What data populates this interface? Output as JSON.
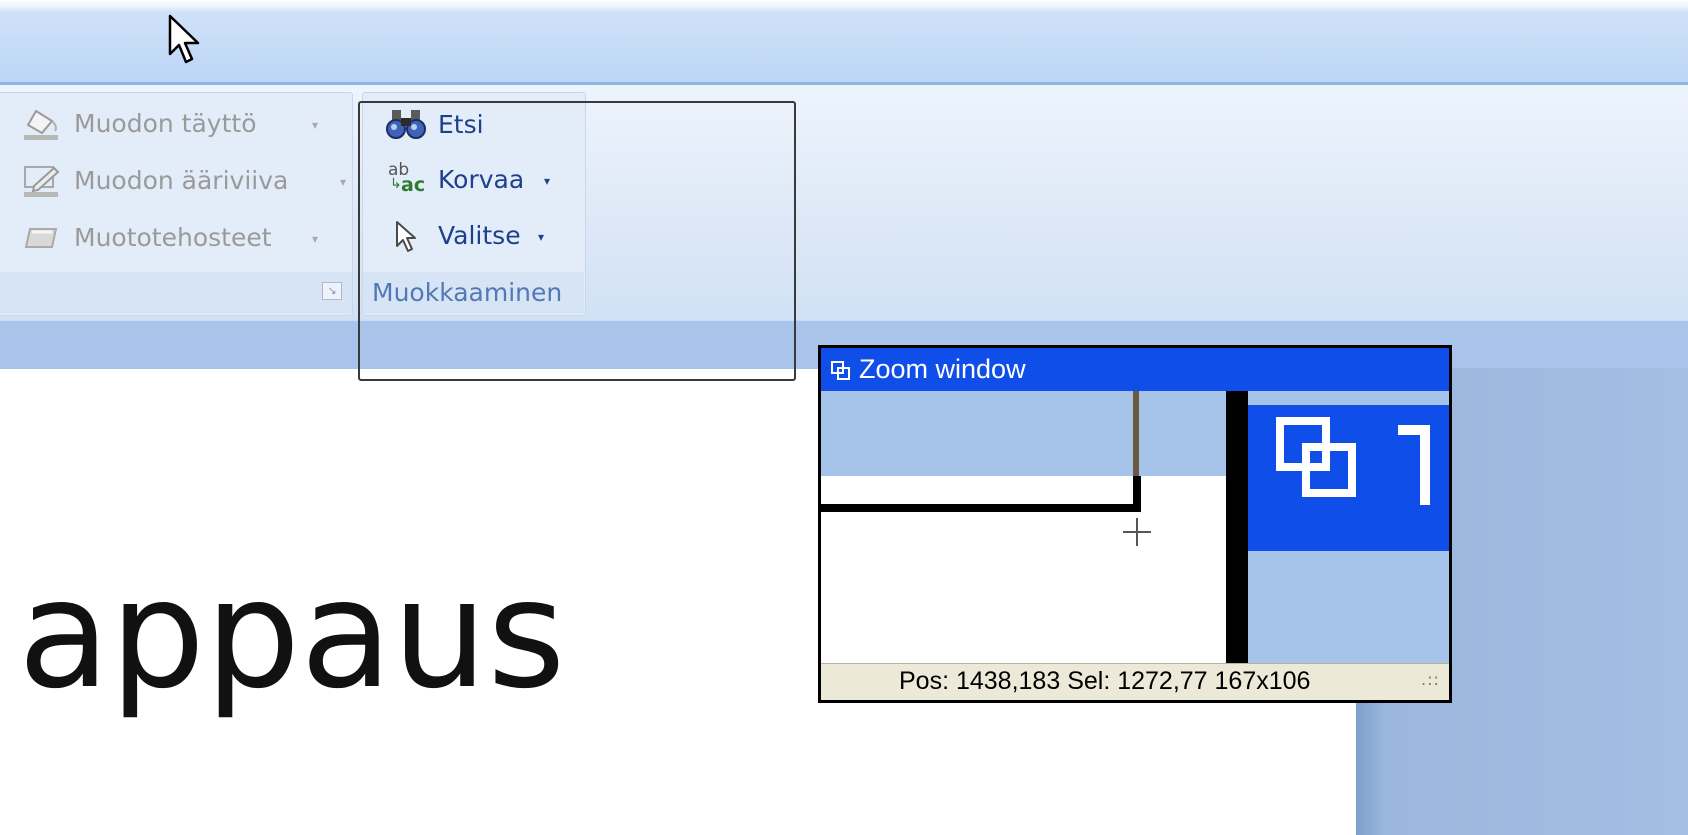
{
  "ribbon": {
    "drawing_group": {
      "items": [
        {
          "label": "Muodon täyttö",
          "icon": "paint-bucket-icon",
          "enabled": false
        },
        {
          "label": "Muodon ääriviiva",
          "icon": "pencil-outline-icon",
          "enabled": false
        },
        {
          "label": "Muototehosteet",
          "icon": "shape-effects-icon",
          "enabled": false
        }
      ],
      "dropdown_arrow": "▾",
      "launcher_icon": "dialog-launcher-icon"
    },
    "editing_group": {
      "label": "Muokkaaminen",
      "items": [
        {
          "label": "Etsi",
          "icon": "binoculars-icon",
          "has_dropdown": false
        },
        {
          "label": "Korvaa",
          "icon": "replace-ab-ac-icon",
          "has_dropdown": true
        },
        {
          "label": "Valitse",
          "icon": "select-cursor-icon",
          "has_dropdown": true
        }
      ],
      "dropdown_arrow": "▾",
      "replace_icon_text": {
        "top": "ab",
        "bottom": "ac"
      }
    }
  },
  "document": {
    "visible_text": "appaus"
  },
  "zoom_window": {
    "title": "Zoom window",
    "title_icon": "zoom-window-icon",
    "status": "Pos: 1438,183  Sel: 1272,77  167x106",
    "grip_icon": "resize-grip-icon",
    "grip_text": ".::",
    "cursor_icon": "crosshair-icon"
  },
  "colors": {
    "title_blue": "#0f4ee8",
    "ribbon_text": "#1e3f8c",
    "disabled_text": "#9a9a9a",
    "group_label": "#5478b5"
  }
}
